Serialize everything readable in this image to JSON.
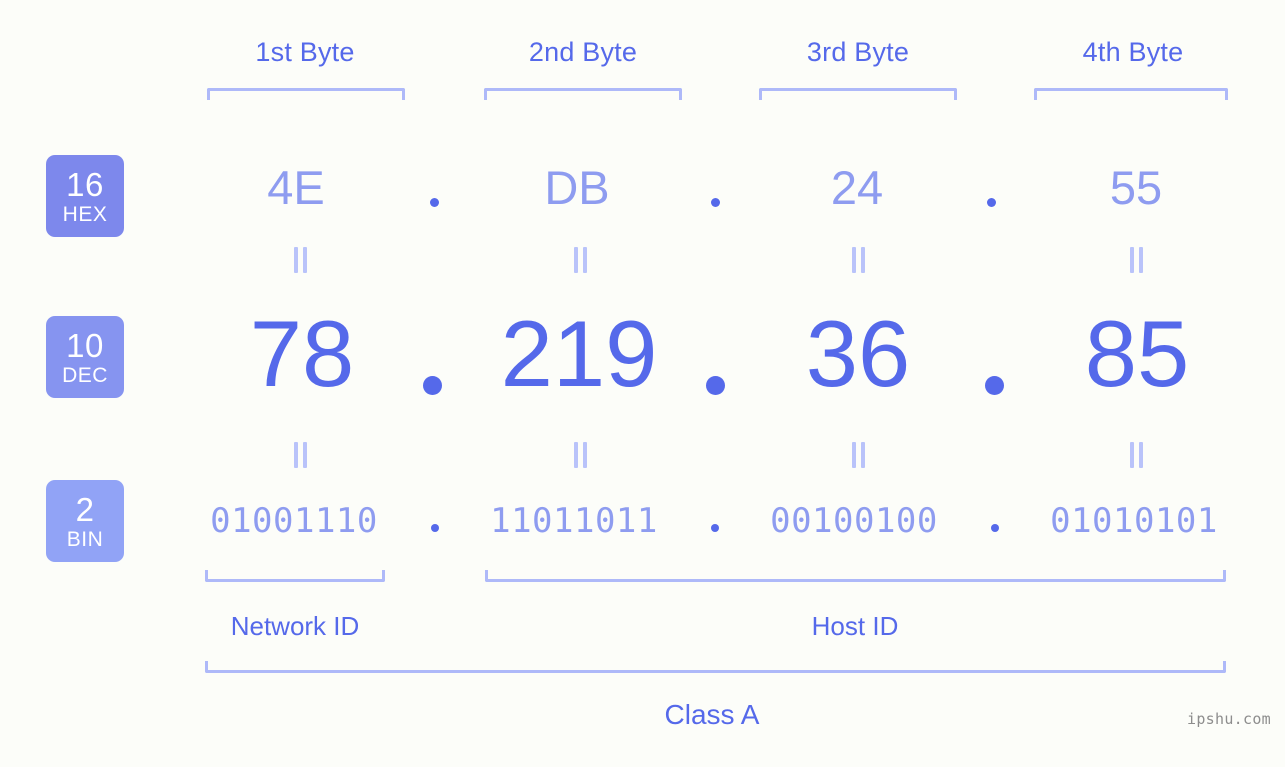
{
  "background_color": "#fcfdf9",
  "accent_color": "#5569ea",
  "accent_light_color": "#8e9cf0",
  "bracket_color": "#aeb9f9",
  "byte_headers": [
    {
      "label": "1st Byte"
    },
    {
      "label": "2nd Byte"
    },
    {
      "label": "3rd Byte"
    },
    {
      "label": "4th Byte"
    }
  ],
  "bases": [
    {
      "number": "16",
      "name": "HEX",
      "color": "#7d88ec"
    },
    {
      "number": "10",
      "name": "DEC",
      "color": "#8694f0"
    },
    {
      "number": "2",
      "name": "BIN",
      "color": "#91a3f6"
    }
  ],
  "rows": {
    "hex": {
      "values": [
        "4E",
        "DB",
        "24",
        "55"
      ],
      "separator": "."
    },
    "dec": {
      "values": [
        "78",
        "219",
        "36",
        "85"
      ],
      "separator": "."
    },
    "bin": {
      "values": [
        "01001110",
        "11011011",
        "00100100",
        "01010101"
      ],
      "separator": "."
    }
  },
  "equals_marker": "=",
  "sections": [
    {
      "label": "Network ID"
    },
    {
      "label": "Host ID"
    }
  ],
  "class": {
    "label": "Class A"
  },
  "watermark": {
    "text": "ipshu.com"
  }
}
